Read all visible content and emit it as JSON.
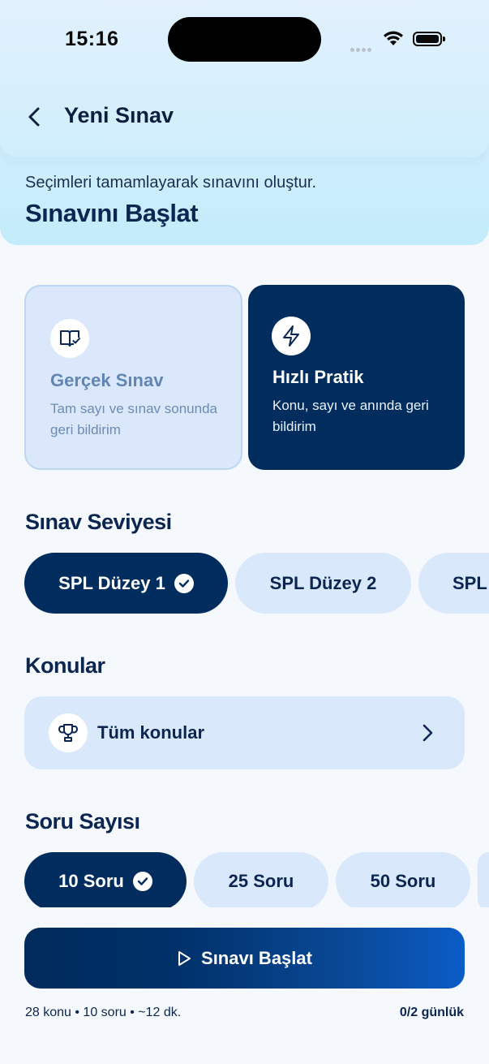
{
  "status_bar": {
    "time": "15:16"
  },
  "nav": {
    "title": "Yeni Sınav"
  },
  "hero": {
    "subtitle": "Seçimleri tamamlayarak sınavını oluştur.",
    "title": "Sınavını Başlat"
  },
  "modes": [
    {
      "title": "Gerçek Sınav",
      "description": "Tam sayı ve sınav sonunda geri bildirim",
      "icon": "book-check-icon",
      "selected": false
    },
    {
      "title": "Hızlı Pratik",
      "description": "Konu, sayı ve anında geri bildirim",
      "icon": "lightning-icon",
      "selected": true
    }
  ],
  "level_section": {
    "title": "Sınav Seviyesi",
    "options": [
      {
        "label": "SPL Düzey 1",
        "selected": true
      },
      {
        "label": "SPL Düzey 2",
        "selected": false
      },
      {
        "label": "SPL",
        "selected": false
      }
    ]
  },
  "topics_section": {
    "title": "Konular",
    "value": "Tüm konular",
    "icon": "trophy-icon"
  },
  "count_section": {
    "title": "Soru Sayısı",
    "options": [
      {
        "label": "10 Soru",
        "selected": true
      },
      {
        "label": "25 Soru",
        "selected": false
      },
      {
        "label": "50 Soru",
        "selected": false
      }
    ]
  },
  "start_button": {
    "label": "Sınavı Başlat",
    "icon": "play-icon"
  },
  "footer": {
    "summary": "28 konu • 10 soru • ~12 dk.",
    "daily": "0/2 günlük"
  },
  "colors": {
    "primary": "#002d5e",
    "pill_bg": "#d9e8fb",
    "background": "#f5f8fc"
  }
}
